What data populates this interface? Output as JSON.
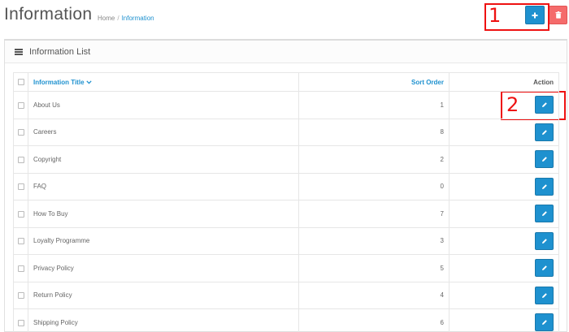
{
  "header": {
    "title": "Information",
    "breadcrumb": [
      {
        "label": "Home"
      },
      {
        "label": "Information"
      }
    ],
    "breadcrumb_separator": "/"
  },
  "callouts": [
    {
      "number": "1"
    },
    {
      "number": "2"
    }
  ],
  "panel": {
    "title": "Information List"
  },
  "table": {
    "columns": {
      "title": "Information Title",
      "sort_order": "Sort Order",
      "action": "Action"
    },
    "rows": [
      {
        "title": "About Us",
        "sort_order": "1"
      },
      {
        "title": "Careers",
        "sort_order": "8"
      },
      {
        "title": "Copyright",
        "sort_order": "2"
      },
      {
        "title": "FAQ",
        "sort_order": "0"
      },
      {
        "title": "How To Buy",
        "sort_order": "7"
      },
      {
        "title": "Loyalty Programme",
        "sort_order": "3"
      },
      {
        "title": "Privacy Policy",
        "sort_order": "5"
      },
      {
        "title": "Return Policy",
        "sort_order": "4"
      },
      {
        "title": "Shipping Policy",
        "sort_order": "6"
      }
    ]
  },
  "colors": {
    "primary": "#1e91cf",
    "danger": "#f56b6b",
    "callout": "#ee1111"
  },
  "icons": {
    "add": "plus-icon",
    "delete": "trash-icon",
    "edit": "pencil-icon",
    "panel": "list-icon",
    "sort": "chevron-down-icon"
  }
}
